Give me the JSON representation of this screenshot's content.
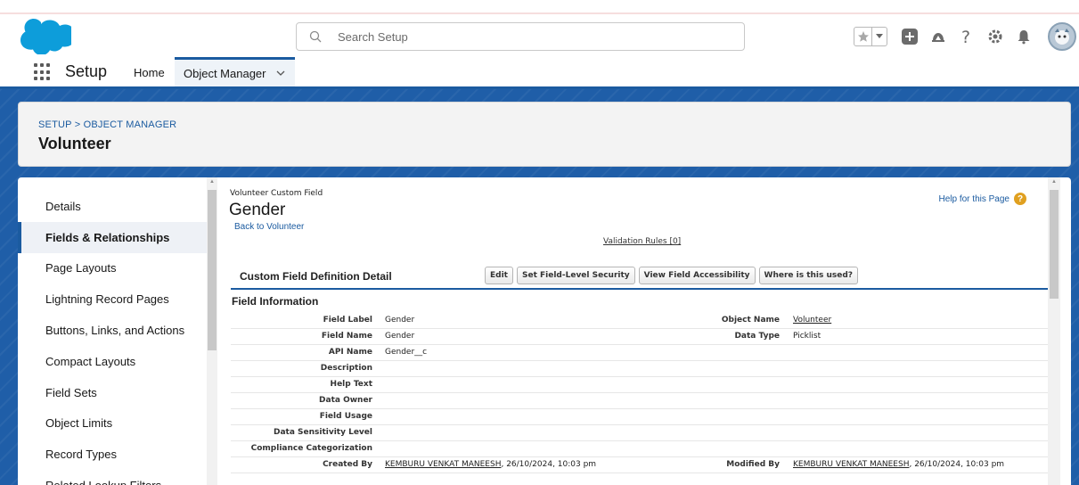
{
  "header": {
    "search_placeholder": "Search Setup"
  },
  "nav": {
    "app_name": "Setup",
    "home": "Home",
    "object_manager": "Object Manager"
  },
  "page_header": {
    "breadcrumb": "SETUP > OBJECT MANAGER",
    "title": "Volunteer"
  },
  "sidebar": {
    "items": [
      {
        "label": "Details"
      },
      {
        "label": "Fields & Relationships"
      },
      {
        "label": "Page Layouts"
      },
      {
        "label": "Lightning Record Pages"
      },
      {
        "label": "Buttons, Links, and Actions"
      },
      {
        "label": "Compact Layouts"
      },
      {
        "label": "Field Sets"
      },
      {
        "label": "Object Limits"
      },
      {
        "label": "Record Types"
      },
      {
        "label": "Related Lookup Filters"
      }
    ],
    "active_index": 1
  },
  "content": {
    "subtitle": "Volunteer Custom Field",
    "title": "Gender",
    "back_link": "Back to Volunteer",
    "help_link": "Help for this Page",
    "validation_rules": "Validation Rules [0]",
    "detail_title": "Custom Field Definition Detail",
    "buttons": {
      "edit": "Edit",
      "field_security": "Set Field-Level Security",
      "field_accessibility": "View Field Accessibility",
      "where_used": "Where is this used?"
    },
    "section_title": "Field Information",
    "rows": [
      {
        "label": "Field Label",
        "value": "Gender",
        "label2": "Object Name",
        "value2": "Volunteer"
      },
      {
        "label": "Field Name",
        "value": "Gender",
        "label2": "Data Type",
        "value2": "Picklist"
      },
      {
        "label": "API Name",
        "value": "Gender__c",
        "label2": "",
        "value2": ""
      },
      {
        "label": "Description",
        "value": "",
        "label2": "",
        "value2": ""
      },
      {
        "label": "Help Text",
        "value": "",
        "label2": "",
        "value2": ""
      },
      {
        "label": "Data Owner",
        "value": "",
        "label2": "",
        "value2": ""
      },
      {
        "label": "Field Usage",
        "value": "",
        "label2": "",
        "value2": ""
      },
      {
        "label": "Data Sensitivity Level",
        "value": "",
        "label2": "",
        "value2": ""
      },
      {
        "label": "Compliance Categorization",
        "value": "",
        "label2": "",
        "value2": ""
      }
    ],
    "created_by": {
      "label": "Created By",
      "user": "KEMBURU VENKAT MANEESH",
      "date": ", 26/10/2024, 10:03 pm",
      "label2": "Modified By",
      "user2": "KEMBURU VENKAT MANEESH",
      "date2": ", 26/10/2024, 10:03 pm"
    }
  },
  "colors": {
    "brand_blue": "#1b5ba0",
    "background_blue": "#1f5ea8",
    "logo_blue": "#0d9dda",
    "help_orange": "#e0a020"
  }
}
